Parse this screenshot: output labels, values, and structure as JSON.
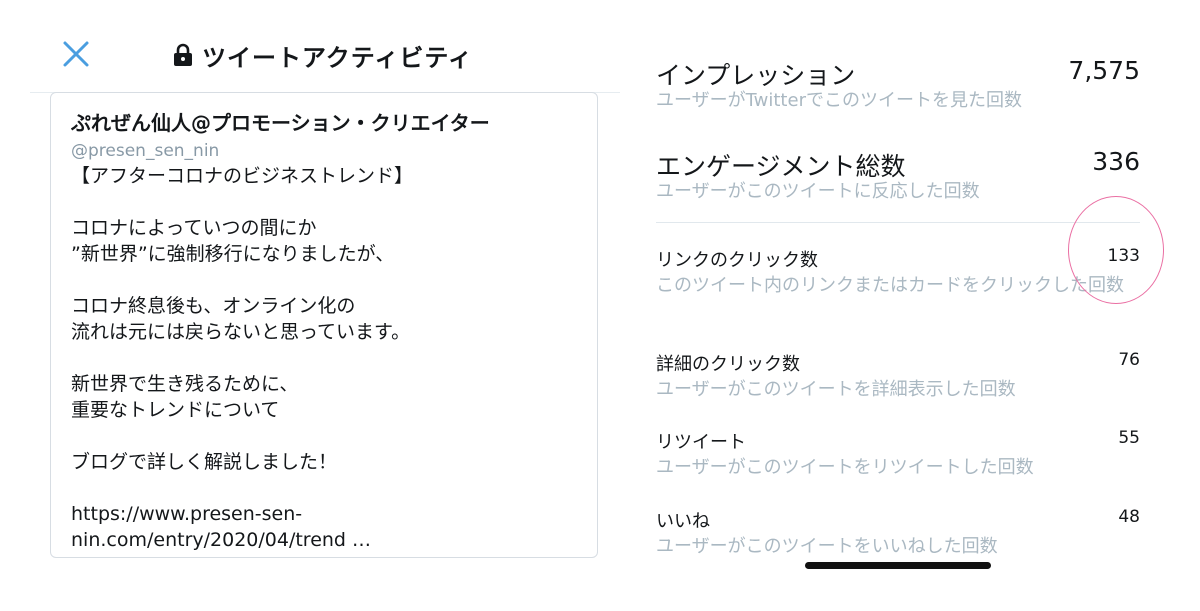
{
  "header": {
    "title": "ツイートアクティビティ",
    "close_icon": "close-icon",
    "lock_icon": "lock-icon",
    "accent_color": "#4a9ee0"
  },
  "tweet": {
    "author": "ぷれぜん仙人@プロモーション・クリエイター",
    "handle": "@presen_sen_nin",
    "lines": [
      "【アフターコロナのビジネストレンド】",
      "",
      "コロナによっていつの間にか",
      "”新世界”に強制移行になりましたが、",
      "",
      "コロナ終息後も、オンライン化の",
      "流れは元には戻らないと思っています。",
      "",
      "新世界で生き残るために、",
      "重要なトレンドについて",
      "",
      "ブログで詳しく解説しました！",
      ""
    ],
    "link_line1": "https://www.presen-sen-",
    "link_line2": "nin.com/entry/2020/04/trend …"
  },
  "metrics": [
    {
      "label": "インプレッション",
      "value": "7,575",
      "desc": "ユーザーがTwitterでこのツイートを見た回数"
    },
    {
      "label": "エンゲージメント総数",
      "value": "336",
      "desc": "ユーザーがこのツイートに反応した回数"
    },
    {
      "label": "リンクのクリック数",
      "value": "133",
      "desc": "このツイート内のリンクまたはカードをクリックした回数"
    },
    {
      "label": "詳細のクリック数",
      "value": "76",
      "desc": "ユーザーがこのツイートを詳細表示した回数"
    },
    {
      "label": "リツイート",
      "value": "55",
      "desc": "ユーザーがこのツイートをリツイートした回数"
    },
    {
      "label": "いいね",
      "value": "48",
      "desc": "ユーザーがこのツイートをいいねした回数"
    }
  ],
  "colors": {
    "muted_text": "#aab8c2",
    "highlight": "#ea6fa3"
  }
}
